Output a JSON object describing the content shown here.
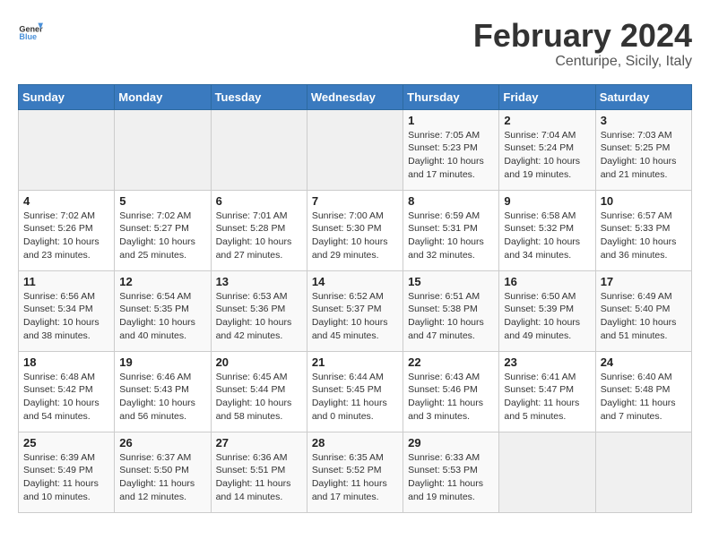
{
  "header": {
    "logo_general": "General",
    "logo_blue": "Blue",
    "title": "February 2024",
    "subtitle": "Centuripe, Sicily, Italy"
  },
  "days_of_week": [
    "Sunday",
    "Monday",
    "Tuesday",
    "Wednesday",
    "Thursday",
    "Friday",
    "Saturday"
  ],
  "weeks": [
    [
      {
        "day": "",
        "empty": true
      },
      {
        "day": "",
        "empty": true
      },
      {
        "day": "",
        "empty": true
      },
      {
        "day": "",
        "empty": true
      },
      {
        "day": "1",
        "sunrise": "7:05 AM",
        "sunset": "5:23 PM",
        "daylight": "10 hours and 17 minutes."
      },
      {
        "day": "2",
        "sunrise": "7:04 AM",
        "sunset": "5:24 PM",
        "daylight": "10 hours and 19 minutes."
      },
      {
        "day": "3",
        "sunrise": "7:03 AM",
        "sunset": "5:25 PM",
        "daylight": "10 hours and 21 minutes."
      }
    ],
    [
      {
        "day": "4",
        "sunrise": "7:02 AM",
        "sunset": "5:26 PM",
        "daylight": "10 hours and 23 minutes."
      },
      {
        "day": "5",
        "sunrise": "7:02 AM",
        "sunset": "5:27 PM",
        "daylight": "10 hours and 25 minutes."
      },
      {
        "day": "6",
        "sunrise": "7:01 AM",
        "sunset": "5:28 PM",
        "daylight": "10 hours and 27 minutes."
      },
      {
        "day": "7",
        "sunrise": "7:00 AM",
        "sunset": "5:30 PM",
        "daylight": "10 hours and 29 minutes."
      },
      {
        "day": "8",
        "sunrise": "6:59 AM",
        "sunset": "5:31 PM",
        "daylight": "10 hours and 32 minutes."
      },
      {
        "day": "9",
        "sunrise": "6:58 AM",
        "sunset": "5:32 PM",
        "daylight": "10 hours and 34 minutes."
      },
      {
        "day": "10",
        "sunrise": "6:57 AM",
        "sunset": "5:33 PM",
        "daylight": "10 hours and 36 minutes."
      }
    ],
    [
      {
        "day": "11",
        "sunrise": "6:56 AM",
        "sunset": "5:34 PM",
        "daylight": "10 hours and 38 minutes."
      },
      {
        "day": "12",
        "sunrise": "6:54 AM",
        "sunset": "5:35 PM",
        "daylight": "10 hours and 40 minutes."
      },
      {
        "day": "13",
        "sunrise": "6:53 AM",
        "sunset": "5:36 PM",
        "daylight": "10 hours and 42 minutes."
      },
      {
        "day": "14",
        "sunrise": "6:52 AM",
        "sunset": "5:37 PM",
        "daylight": "10 hours and 45 minutes."
      },
      {
        "day": "15",
        "sunrise": "6:51 AM",
        "sunset": "5:38 PM",
        "daylight": "10 hours and 47 minutes."
      },
      {
        "day": "16",
        "sunrise": "6:50 AM",
        "sunset": "5:39 PM",
        "daylight": "10 hours and 49 minutes."
      },
      {
        "day": "17",
        "sunrise": "6:49 AM",
        "sunset": "5:40 PM",
        "daylight": "10 hours and 51 minutes."
      }
    ],
    [
      {
        "day": "18",
        "sunrise": "6:48 AM",
        "sunset": "5:42 PM",
        "daylight": "10 hours and 54 minutes."
      },
      {
        "day": "19",
        "sunrise": "6:46 AM",
        "sunset": "5:43 PM",
        "daylight": "10 hours and 56 minutes."
      },
      {
        "day": "20",
        "sunrise": "6:45 AM",
        "sunset": "5:44 PM",
        "daylight": "10 hours and 58 minutes."
      },
      {
        "day": "21",
        "sunrise": "6:44 AM",
        "sunset": "5:45 PM",
        "daylight": "11 hours and 0 minutes."
      },
      {
        "day": "22",
        "sunrise": "6:43 AM",
        "sunset": "5:46 PM",
        "daylight": "11 hours and 3 minutes."
      },
      {
        "day": "23",
        "sunrise": "6:41 AM",
        "sunset": "5:47 PM",
        "daylight": "11 hours and 5 minutes."
      },
      {
        "day": "24",
        "sunrise": "6:40 AM",
        "sunset": "5:48 PM",
        "daylight": "11 hours and 7 minutes."
      }
    ],
    [
      {
        "day": "25",
        "sunrise": "6:39 AM",
        "sunset": "5:49 PM",
        "daylight": "11 hours and 10 minutes."
      },
      {
        "day": "26",
        "sunrise": "6:37 AM",
        "sunset": "5:50 PM",
        "daylight": "11 hours and 12 minutes."
      },
      {
        "day": "27",
        "sunrise": "6:36 AM",
        "sunset": "5:51 PM",
        "daylight": "11 hours and 14 minutes."
      },
      {
        "day": "28",
        "sunrise": "6:35 AM",
        "sunset": "5:52 PM",
        "daylight": "11 hours and 17 minutes."
      },
      {
        "day": "29",
        "sunrise": "6:33 AM",
        "sunset": "5:53 PM",
        "daylight": "11 hours and 19 minutes."
      },
      {
        "day": "",
        "empty": true
      },
      {
        "day": "",
        "empty": true
      }
    ]
  ]
}
